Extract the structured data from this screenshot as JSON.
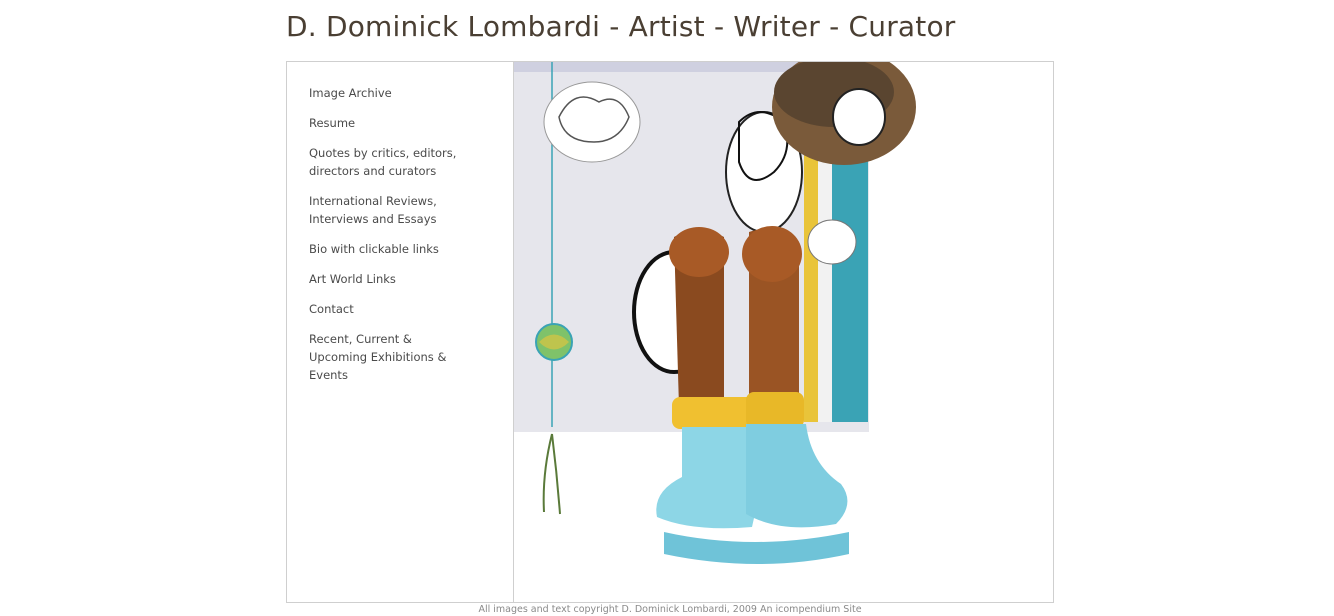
{
  "header": {
    "title": "D. Dominick Lombardi - Artist - Writer - Curator"
  },
  "nav": {
    "items": [
      {
        "label": "Image Archive",
        "name": "nav-image-archive"
      },
      {
        "label": "Resume",
        "name": "nav-resume"
      },
      {
        "label": "Quotes by critics, editors, directors and curators",
        "name": "nav-quotes"
      },
      {
        "label": "International Reviews, Interviews and Essays",
        "name": "nav-reviews"
      },
      {
        "label": "Bio with clickable links",
        "name": "nav-bio"
      },
      {
        "label": "Art World Links",
        "name": "nav-art-world-links"
      },
      {
        "label": "Contact",
        "name": "nav-contact"
      },
      {
        "label": "Recent, Current & Upcoming Exhibitions & Events",
        "name": "nav-exhibitions"
      }
    ]
  },
  "footer": {
    "text": "All images and text copyright D. Dominick Lombardi, 2009 An icompendium Site"
  },
  "colors": {
    "title": "#4a3f33",
    "canvas": "#e6e6ec",
    "teal": "#3aa3b5",
    "yellow": "#e9c43a",
    "skin": "#8a4a1f",
    "socks": "#f0c030",
    "shoes": "#8dd6e6",
    "wood": "#7a5a3a"
  }
}
